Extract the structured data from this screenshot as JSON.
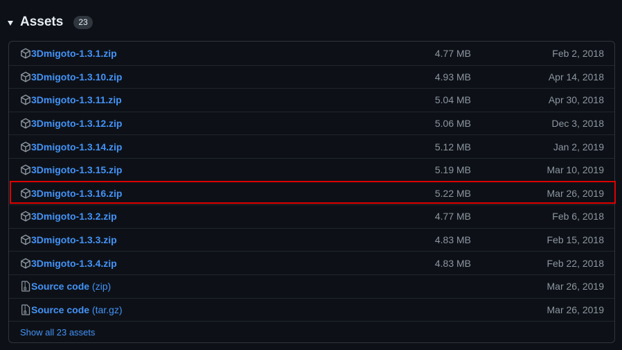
{
  "header": {
    "title": "Assets",
    "count": "23"
  },
  "assets": [
    {
      "name": "3Dmigoto-1.3.1.zip",
      "size": "4.77 MB",
      "date": "Feb 2, 2018",
      "icon": "package-icon"
    },
    {
      "name": "3Dmigoto-1.3.10.zip",
      "size": "4.93 MB",
      "date": "Apr 14, 2018",
      "icon": "package-icon"
    },
    {
      "name": "3Dmigoto-1.3.11.zip",
      "size": "5.04 MB",
      "date": "Apr 30, 2018",
      "icon": "package-icon"
    },
    {
      "name": "3Dmigoto-1.3.12.zip",
      "size": "5.06 MB",
      "date": "Dec 3, 2018",
      "icon": "package-icon"
    },
    {
      "name": "3Dmigoto-1.3.14.zip",
      "size": "5.12 MB",
      "date": "Jan 2, 2019",
      "icon": "package-icon"
    },
    {
      "name": "3Dmigoto-1.3.15.zip",
      "size": "5.19 MB",
      "date": "Mar 10, 2019",
      "icon": "package-icon"
    },
    {
      "name": "3Dmigoto-1.3.16.zip",
      "size": "5.22 MB",
      "date": "Mar 26, 2019",
      "icon": "package-icon",
      "highlighted": true
    },
    {
      "name": "3Dmigoto-1.3.2.zip",
      "size": "4.77 MB",
      "date": "Feb 6, 2018",
      "icon": "package-icon"
    },
    {
      "name": "3Dmigoto-1.3.3.zip",
      "size": "4.83 MB",
      "date": "Feb 15, 2018",
      "icon": "package-icon"
    },
    {
      "name": "3Dmigoto-1.3.4.zip",
      "size": "4.83 MB",
      "date": "Feb 22, 2018",
      "icon": "package-icon"
    }
  ],
  "source": [
    {
      "name": "Source code",
      "suffix": "(zip)",
      "date": "Mar 26, 2019",
      "icon": "file-zip-icon"
    },
    {
      "name": "Source code",
      "suffix": "(tar.gz)",
      "date": "Mar 26, 2019",
      "icon": "file-zip-icon"
    }
  ],
  "show_all": "Show all 23 assets",
  "colors": {
    "link": "#4493f8",
    "muted": "#8d96a0",
    "highlight_border": "#e00000",
    "background": "#0d1117"
  }
}
